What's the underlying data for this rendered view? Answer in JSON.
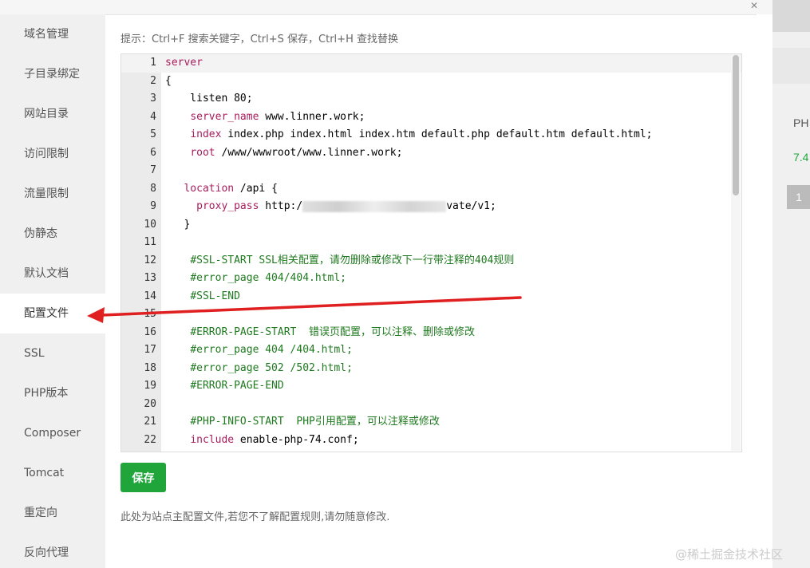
{
  "background": {
    "column_header": "PH",
    "php_version": "7.4",
    "page_number": "1"
  },
  "sidebar": {
    "items": [
      {
        "label": "域名管理"
      },
      {
        "label": "子目录绑定"
      },
      {
        "label": "网站目录"
      },
      {
        "label": "访问限制"
      },
      {
        "label": "流量限制"
      },
      {
        "label": "伪静态"
      },
      {
        "label": "默认文档"
      },
      {
        "label": "配置文件",
        "active": true
      },
      {
        "label": "SSL"
      },
      {
        "label": "PHP版本"
      },
      {
        "label": "Composer"
      },
      {
        "label": "Tomcat"
      },
      {
        "label": "重定向"
      },
      {
        "label": "反向代理"
      }
    ]
  },
  "editor": {
    "tip": "提示：Ctrl+F 搜索关键字，Ctrl+S 保存，Ctrl+H 查找替换",
    "lines": [
      {
        "n": "1",
        "parts": [
          {
            "t": "server",
            "c": "kw"
          }
        ]
      },
      {
        "n": "2",
        "parts": [
          {
            "t": "{"
          }
        ]
      },
      {
        "n": "3",
        "parts": [
          {
            "t": "    listen 80;"
          }
        ]
      },
      {
        "n": "4",
        "parts": [
          {
            "t": "    "
          },
          {
            "t": "server_name",
            "c": "dir"
          },
          {
            "t": " www.linner.work;"
          }
        ]
      },
      {
        "n": "5",
        "parts": [
          {
            "t": "    "
          },
          {
            "t": "index",
            "c": "dir"
          },
          {
            "t": " index.php index.html index.htm default.php default.htm default.html;"
          }
        ]
      },
      {
        "n": "6",
        "parts": [
          {
            "t": "    "
          },
          {
            "t": "root",
            "c": "dir"
          },
          {
            "t": " /www/wwwroot/www.linner.work;"
          }
        ]
      },
      {
        "n": "7",
        "parts": [
          {
            "t": ""
          }
        ]
      },
      {
        "n": "8",
        "parts": [
          {
            "t": "   "
          },
          {
            "t": "location",
            "c": "dir"
          },
          {
            "t": " /api {"
          }
        ]
      },
      {
        "n": "9",
        "parts": [
          {
            "t": "     "
          },
          {
            "t": "proxy_pass",
            "c": "dir"
          },
          {
            "t": " http:/"
          },
          {
            "t": "",
            "blur": true
          },
          {
            "t": "vate/v1;"
          }
        ]
      },
      {
        "n": "10",
        "parts": [
          {
            "t": "   }"
          }
        ]
      },
      {
        "n": "11",
        "parts": [
          {
            "t": ""
          }
        ]
      },
      {
        "n": "12",
        "parts": [
          {
            "t": "    "
          },
          {
            "t": "#SSL-START SSL相关配置，请勿删除或修改下一行带注释的404规则",
            "c": "cm"
          }
        ]
      },
      {
        "n": "13",
        "parts": [
          {
            "t": "    "
          },
          {
            "t": "#error_page 404/404.html;",
            "c": "cm"
          }
        ]
      },
      {
        "n": "14",
        "parts": [
          {
            "t": "    "
          },
          {
            "t": "#SSL-END",
            "c": "cm"
          }
        ]
      },
      {
        "n": "15",
        "parts": [
          {
            "t": ""
          }
        ]
      },
      {
        "n": "16",
        "parts": [
          {
            "t": "    "
          },
          {
            "t": "#ERROR-PAGE-START  错误页配置，可以注释、删除或修改",
            "c": "cm"
          }
        ]
      },
      {
        "n": "17",
        "parts": [
          {
            "t": "    "
          },
          {
            "t": "#error_page 404 /404.html;",
            "c": "cm"
          }
        ]
      },
      {
        "n": "18",
        "parts": [
          {
            "t": "    "
          },
          {
            "t": "#error_page 502 /502.html;",
            "c": "cm"
          }
        ]
      },
      {
        "n": "19",
        "parts": [
          {
            "t": "    "
          },
          {
            "t": "#ERROR-PAGE-END",
            "c": "cm"
          }
        ]
      },
      {
        "n": "20",
        "parts": [
          {
            "t": ""
          }
        ]
      },
      {
        "n": "21",
        "parts": [
          {
            "t": "    "
          },
          {
            "t": "#PHP-INFO-START  PHP引用配置，可以注释或修改",
            "c": "cm"
          }
        ]
      },
      {
        "n": "22",
        "parts": [
          {
            "t": "    "
          },
          {
            "t": "include",
            "c": "dir"
          },
          {
            "t": " enable-php-74.conf;"
          }
        ]
      }
    ]
  },
  "actions": {
    "save_label": "保存"
  },
  "note": "此处为站点主配置文件,若您不了解配置规则,请勿随意修改.",
  "watermark": "@稀土掘金技术社区",
  "colors": {
    "accent": "#20a53a",
    "arrow": "#e02020",
    "comment": "#1f7a1f",
    "keyword": "#a71d5d"
  }
}
